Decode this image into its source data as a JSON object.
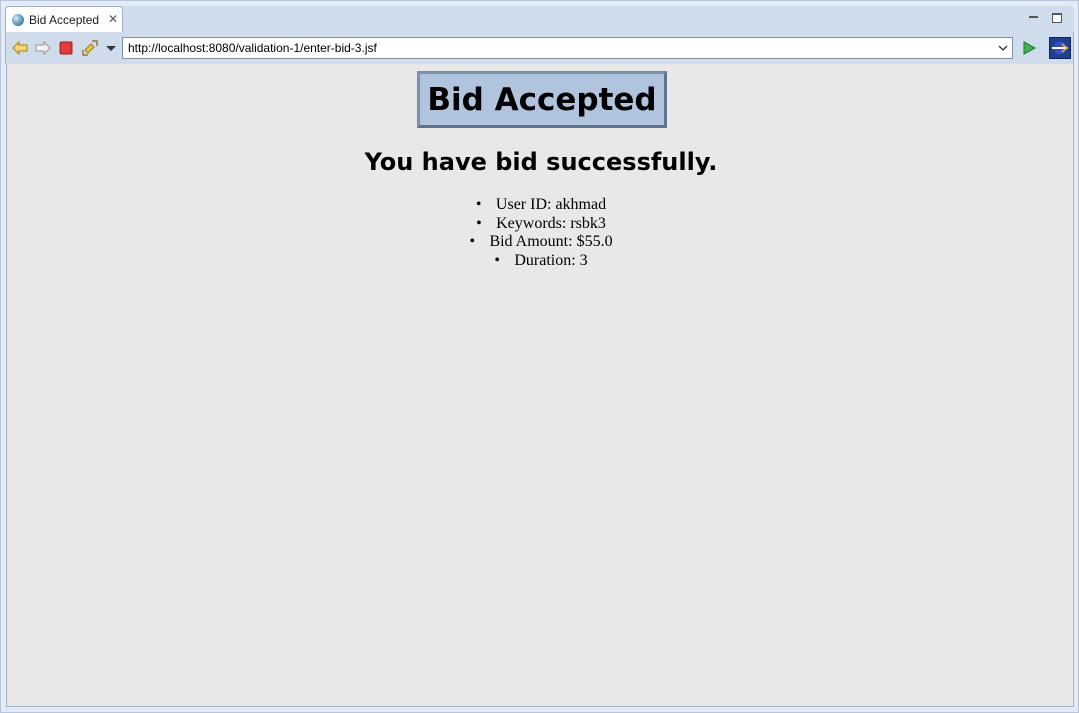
{
  "tab": {
    "title": "Bid Accepted",
    "close_icon": "close-icon"
  },
  "toolbar": {
    "url": "http://localhost:8080/validation-1/enter-bid-3.jsf",
    "icons": [
      "back-arrow-icon",
      "forward-arrow-icon",
      "stop-icon",
      "refresh-icon",
      "chevron-down-icon",
      "go-icon",
      "eclipse-icon"
    ]
  },
  "page": {
    "heading": "Bid Accepted",
    "subheading": "You have bid successfully.",
    "details": [
      "User ID: akhmad",
      "Keywords: rsbk3",
      "Bid Amount: $55.0",
      "Duration: 3"
    ]
  },
  "colors": {
    "heading_background": "#b0c4de",
    "heading_border": "#5c7391",
    "content_background": "#e8e8e8",
    "chrome_background": "#cfdcec"
  }
}
